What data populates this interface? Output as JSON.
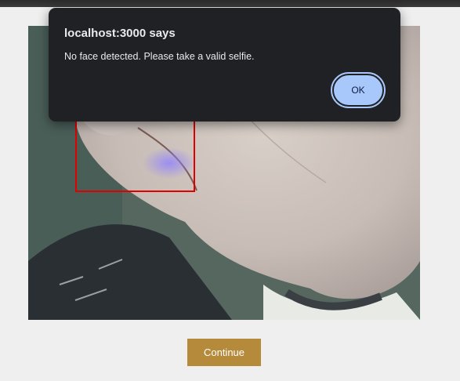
{
  "dialog": {
    "title": "localhost:3000 says",
    "message": "No face detected. Please take a valid selfie.",
    "ok_label": "OK"
  },
  "actions": {
    "continue_label": "Continue"
  },
  "colors": {
    "page_background": "#efefef",
    "dialog_background": "#202124",
    "ok_button": "#a8c7fa",
    "continue_button": "#b58a3a",
    "detection_box": "#e00000"
  }
}
